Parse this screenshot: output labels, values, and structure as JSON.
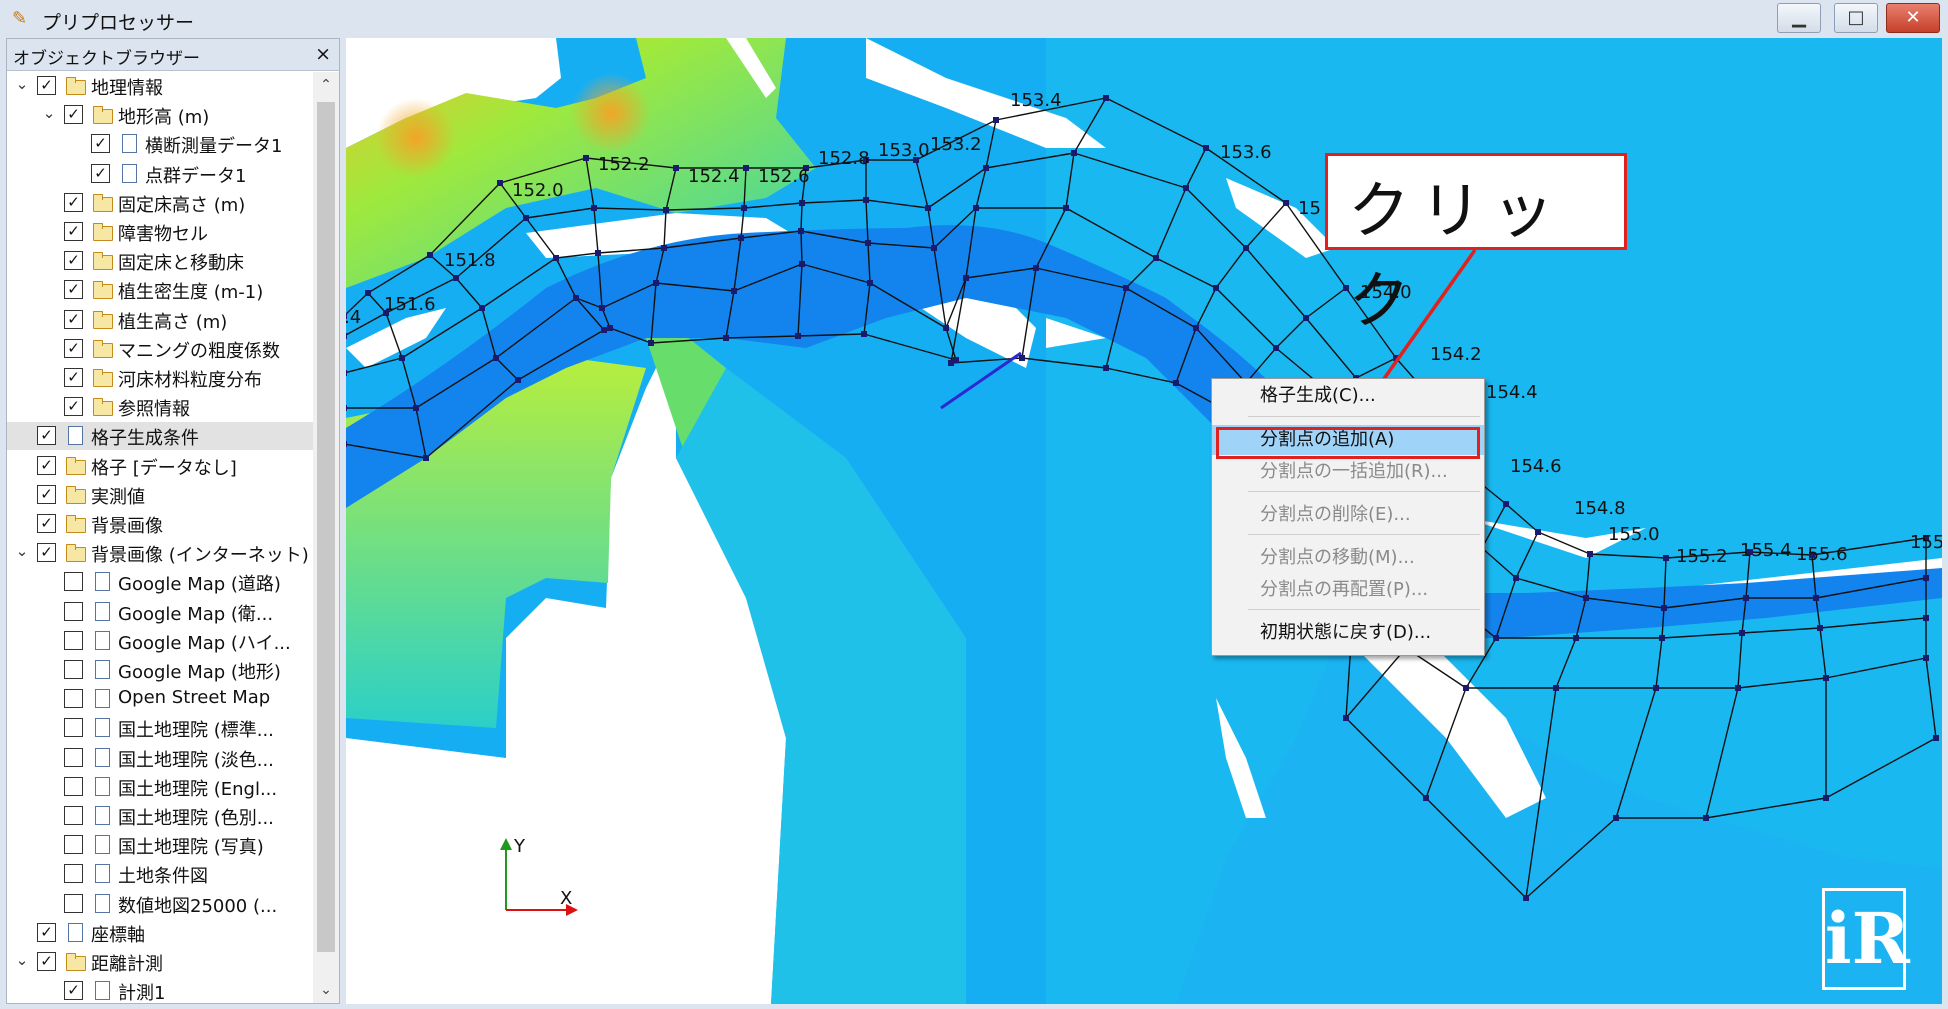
{
  "window": {
    "title": "プリプロセッサー",
    "minimize": "▁",
    "maximize": "□",
    "close": "✕"
  },
  "object_browser": {
    "title": "オブジェクトブラウザー",
    "close": "×",
    "items": [
      {
        "label": "地理情報",
        "checked": true,
        "icon": "folder-icon",
        "expander": "expanded"
      },
      {
        "label": "地形高 (m)",
        "checked": true,
        "icon": "folder-icon",
        "expander": "expanded"
      },
      {
        "label": "横断測量データ1",
        "checked": true,
        "icon": "document-icon"
      },
      {
        "label": "点群データ1",
        "checked": true,
        "icon": "document-icon"
      },
      {
        "label": "固定床高さ (m)",
        "checked": true,
        "icon": "folder-icon"
      },
      {
        "label": "障害物セル",
        "checked": true,
        "icon": "folder-icon"
      },
      {
        "label": "固定床と移動床",
        "checked": true,
        "icon": "folder-icon"
      },
      {
        "label": "植生密生度 (m-1)",
        "checked": true,
        "icon": "folder-icon"
      },
      {
        "label": "植生高さ (m)",
        "checked": true,
        "icon": "folder-icon"
      },
      {
        "label": "マニングの粗度係数",
        "checked": true,
        "icon": "folder-icon"
      },
      {
        "label": "河床材料粒度分布",
        "checked": true,
        "icon": "folder-icon"
      },
      {
        "label": "参照情報",
        "checked": true,
        "icon": "folder-icon"
      },
      {
        "label": "格子生成条件",
        "checked": true,
        "icon": "document-icon",
        "selected": true
      },
      {
        "label": "格子 [データなし]",
        "checked": true,
        "icon": "folder-icon"
      },
      {
        "label": "実測値",
        "checked": true,
        "icon": "folder-icon"
      },
      {
        "label": "背景画像",
        "checked": true,
        "icon": "folder-icon"
      },
      {
        "label": "背景画像 (インターネット)",
        "checked": true,
        "icon": "folder-icon",
        "expander": "expanded"
      },
      {
        "label": "Google Map (道路)",
        "checked": false,
        "icon": "document-icon"
      },
      {
        "label": "Google Map (衛...",
        "checked": false,
        "icon": "document-icon"
      },
      {
        "label": "Google Map (ハイ...",
        "checked": false,
        "icon": "document-icon"
      },
      {
        "label": "Google Map (地形)",
        "checked": false,
        "icon": "document-icon"
      },
      {
        "label": "Open Street Map",
        "checked": false,
        "icon": "document-icon"
      },
      {
        "label": "国土地理院 (標準...",
        "checked": false,
        "icon": "document-icon"
      },
      {
        "label": "国土地理院 (淡色...",
        "checked": false,
        "icon": "document-icon"
      },
      {
        "label": "国土地理院 (Engl...",
        "checked": false,
        "icon": "document-icon"
      },
      {
        "label": "国土地理院 (色別...",
        "checked": false,
        "icon": "document-icon"
      },
      {
        "label": "国土地理院 (写真)",
        "checked": false,
        "icon": "document-icon"
      },
      {
        "label": "土地条件図",
        "checked": false,
        "icon": "document-icon"
      },
      {
        "label": "数値地図25000 (...",
        "checked": false,
        "icon": "document-icon"
      },
      {
        "label": "座標軸",
        "checked": true,
        "icon": "document-icon"
      },
      {
        "label": "距離計測",
        "checked": true,
        "icon": "folder-icon",
        "expander": "expanded"
      },
      {
        "label": "計測1",
        "checked": true,
        "icon": "document-icon"
      }
    ]
  },
  "map": {
    "cross_section_labels": [
      ".4",
      "151.6",
      "151.8",
      "152.0",
      "152.2",
      "152.4",
      "152.6",
      "152.8",
      "153.0",
      "153.2",
      "153.4",
      "153.6",
      "15",
      "154.0",
      "154.2",
      "154.4",
      "154.6",
      "154.8",
      "155.0",
      "155.2",
      "155.4",
      "155.6",
      "155"
    ],
    "axis_y": "Y",
    "axis_x": "X"
  },
  "context_menu": {
    "items": [
      {
        "label": "格子生成(C)...",
        "enabled": true
      },
      {
        "label": "分割点の追加(A)",
        "enabled": true,
        "highlighted": true
      },
      {
        "label": "分割点の一括追加(R)...",
        "enabled": false
      },
      {
        "label": "分割点の削除(E)...",
        "enabled": false
      },
      {
        "label": "分割点の移動(M)...",
        "enabled": false
      },
      {
        "label": "分割点の再配置(P)...",
        "enabled": false
      },
      {
        "label": "初期状態に戻す(D)...",
        "enabled": true
      }
    ]
  },
  "annotation": {
    "callout_text": "クリック",
    "color": "#e0211e"
  },
  "colors": {
    "water": "#14a8f5",
    "channel": "#1386ee",
    "land_high": "#7fe34a",
    "grid": "#111111",
    "node": "#1a1a6e"
  }
}
